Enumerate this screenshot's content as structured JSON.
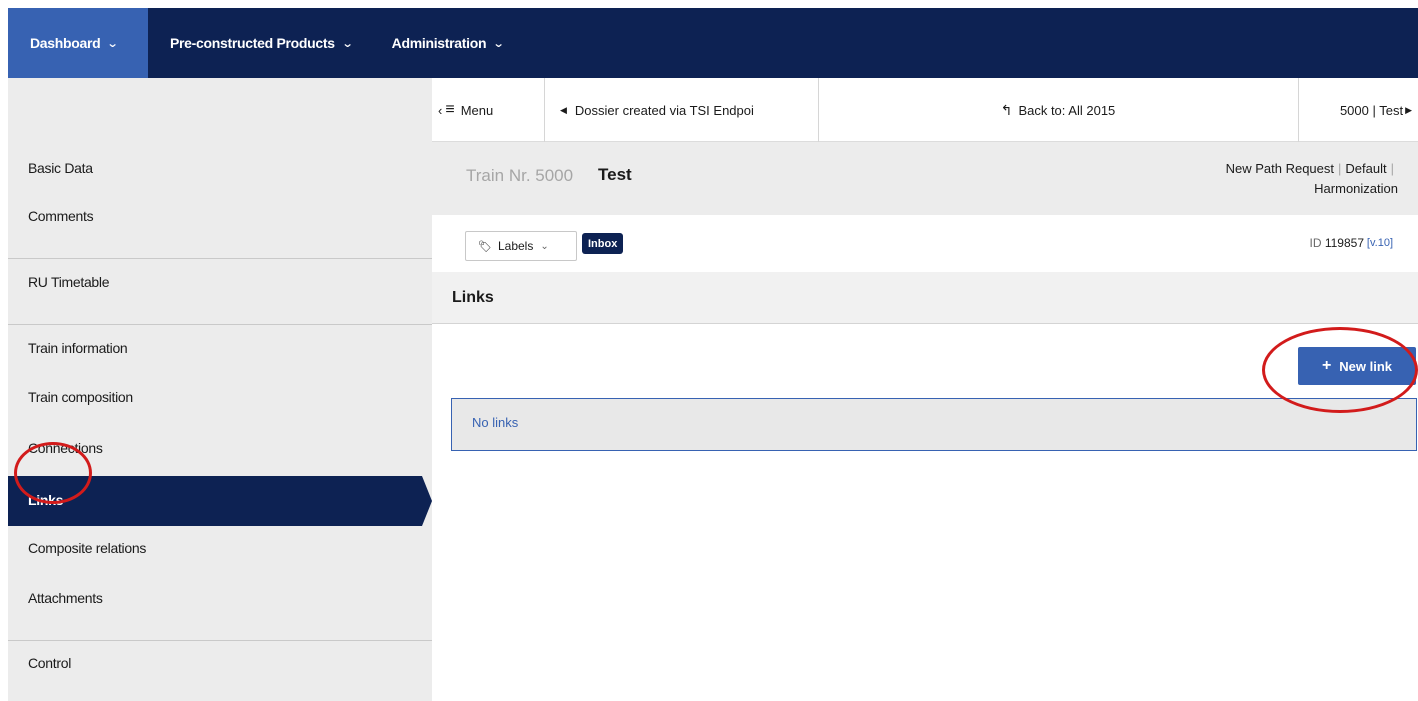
{
  "topnav": {
    "items": [
      {
        "label": "Dashboard"
      },
      {
        "label": "Pre-constructed Products"
      },
      {
        "label": "Administration"
      }
    ]
  },
  "sidebar": {
    "items": [
      {
        "label": "Basic Data"
      },
      {
        "label": "Comments"
      },
      {
        "label": "RU Timetable"
      },
      {
        "label": "Train information"
      },
      {
        "label": "Train composition"
      },
      {
        "label": "Connections"
      },
      {
        "label": "Links"
      },
      {
        "label": "Composite relations"
      },
      {
        "label": "Attachments"
      },
      {
        "label": "Control"
      }
    ]
  },
  "toolbar": {
    "menu_label": "Menu",
    "prev_label": "Dossier created via TSI Endpoi",
    "back_label": "Back to: All 2015",
    "next_label": "5000 | Test"
  },
  "train": {
    "nr_label": "Train Nr. 5000",
    "name": "Test",
    "link_new_path": "New Path Request",
    "link_default": "Default",
    "link_harmonization": "Harmonization"
  },
  "labels_row": {
    "labels_button": "Labels",
    "inbox_badge": "Inbox",
    "id_prefix": "ID",
    "id_value": "119857",
    "version": "[v.10]"
  },
  "links_section": {
    "title": "Links",
    "new_link_label": "New link",
    "empty_message": "No links"
  },
  "colors": {
    "nav_dark": "#0d2253",
    "accent_blue": "#3762b2",
    "annotation_red": "#d21b1b"
  }
}
